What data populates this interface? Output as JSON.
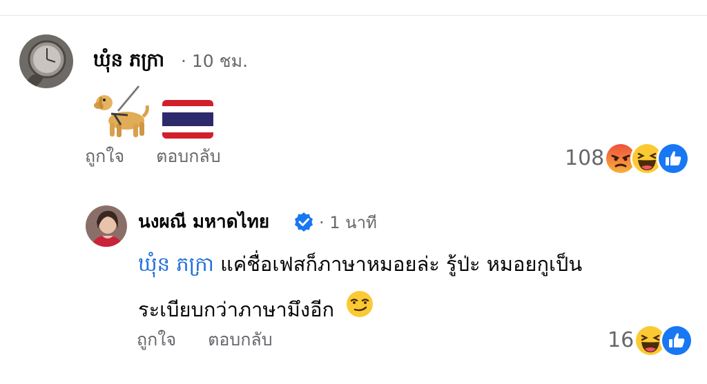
{
  "comment": {
    "author": "ឃុំន ភក្រា",
    "meta": "· 10 ชม.",
    "emojis": [
      "dog-icon",
      "thailand-flag-icon"
    ],
    "actions": {
      "like": "ถูกใจ",
      "reply": "ตอบกลับ"
    },
    "reaction_count": "108",
    "reaction_types": [
      "angry",
      "haha",
      "like"
    ]
  },
  "reply": {
    "author": "นงผณี มหาดไทย",
    "verified": true,
    "meta": "· 1 นาที",
    "mention": "ឃុំន ភក្រា",
    "text_line1": " แค่ชื่อเฟสก็ภาษาหมอยล่ะ รู้ป่ะ หมอยกูเป็น",
    "text_line2": "ระเบียบกว่าภาษามึงอีก",
    "trailing_emoji": "smirk",
    "actions": {
      "like": "ถูกใจ",
      "reply": "ตอบกลับ"
    },
    "reaction_count": "16",
    "reaction_types": [
      "haha",
      "like"
    ]
  },
  "colors": {
    "mention": "#216fdb",
    "meta": "#65676b",
    "like_blue": "#1877f2",
    "angry_red": "#f0503c",
    "haha_yellow": "#fbc933"
  }
}
